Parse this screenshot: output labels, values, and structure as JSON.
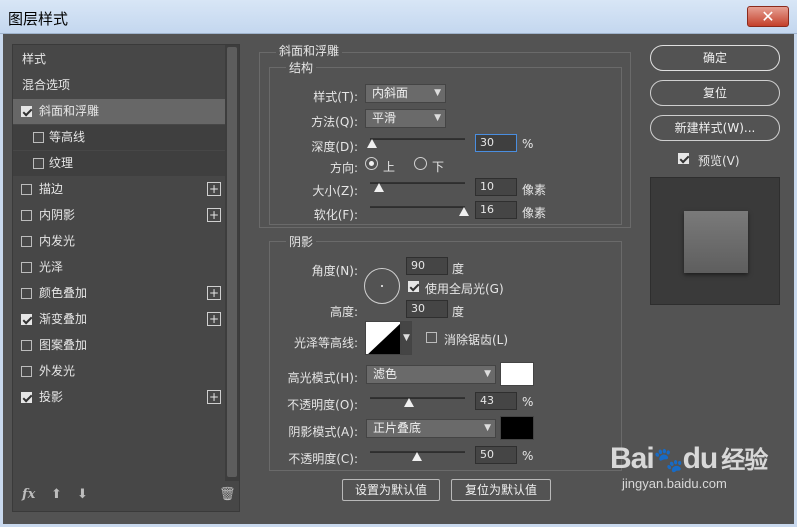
{
  "window": {
    "title": "图层样式",
    "close_label": "✕"
  },
  "left_panel": {
    "header": "样式",
    "blend_options": "混合选项",
    "items": [
      {
        "label": "斜面和浮雕",
        "checked": true,
        "plus": false
      },
      {
        "label": "等高线",
        "checked": false,
        "plus": false
      },
      {
        "label": "纹理",
        "checked": false,
        "plus": false
      },
      {
        "label": "描边",
        "checked": false,
        "plus": true
      },
      {
        "label": "内阴影",
        "checked": false,
        "plus": true
      },
      {
        "label": "内发光",
        "checked": false,
        "plus": false
      },
      {
        "label": "光泽",
        "checked": false,
        "plus": false
      },
      {
        "label": "颜色叠加",
        "checked": false,
        "plus": true
      },
      {
        "label": "渐变叠加",
        "checked": true,
        "plus": true
      },
      {
        "label": "图案叠加",
        "checked": false,
        "plus": false
      },
      {
        "label": "外发光",
        "checked": false,
        "plus": false
      },
      {
        "label": "投影",
        "checked": true,
        "plus": true
      }
    ],
    "fx_label": "fx"
  },
  "bevel": {
    "group_title": "斜面和浮雕",
    "structure_title": "结构",
    "style_label": "样式(T):",
    "style_value": "内斜面",
    "technique_label": "方法(Q):",
    "technique_value": "平滑",
    "depth_label": "深度(D):",
    "depth_value": "30",
    "depth_unit": "%",
    "direction_label": "方向:",
    "direction_up": "上",
    "direction_down": "下",
    "size_label": "大小(Z):",
    "size_value": "10",
    "size_unit": "像素",
    "soften_label": "软化(F):",
    "soften_value": "16",
    "soften_unit": "像素"
  },
  "shading": {
    "group_title": "阴影",
    "angle_label": "角度(N):",
    "angle_value": "90",
    "angle_unit": "度",
    "global_light_label": "使用全局光(G)",
    "altitude_label": "高度:",
    "altitude_value": "30",
    "altitude_unit": "度",
    "gloss_label": "光泽等高线:",
    "antialias_label": "消除锯齿(L)",
    "highlight_label": "高光模式(H):",
    "highlight_mode": "滤色",
    "highlight_color": "#ffffff",
    "highlight_opacity_label": "不透明度(O):",
    "highlight_opacity": "43",
    "shadow_label": "阴影模式(A):",
    "shadow_mode": "正片叠底",
    "shadow_color": "#000000",
    "shadow_opacity_label": "不透明度(C):",
    "shadow_opacity": "50",
    "percent": "%"
  },
  "bottom_buttons": {
    "set_default": "设置为默认值",
    "reset_default": "复位为默认值"
  },
  "right_panel": {
    "ok": "确定",
    "reset": "复位",
    "new_style": "新建样式(W)...",
    "preview_label": "预览(V)"
  },
  "watermark": {
    "brand": "Bai",
    "brand2": "du",
    "cn": "经验",
    "url": "jingyan.baidu.com"
  }
}
